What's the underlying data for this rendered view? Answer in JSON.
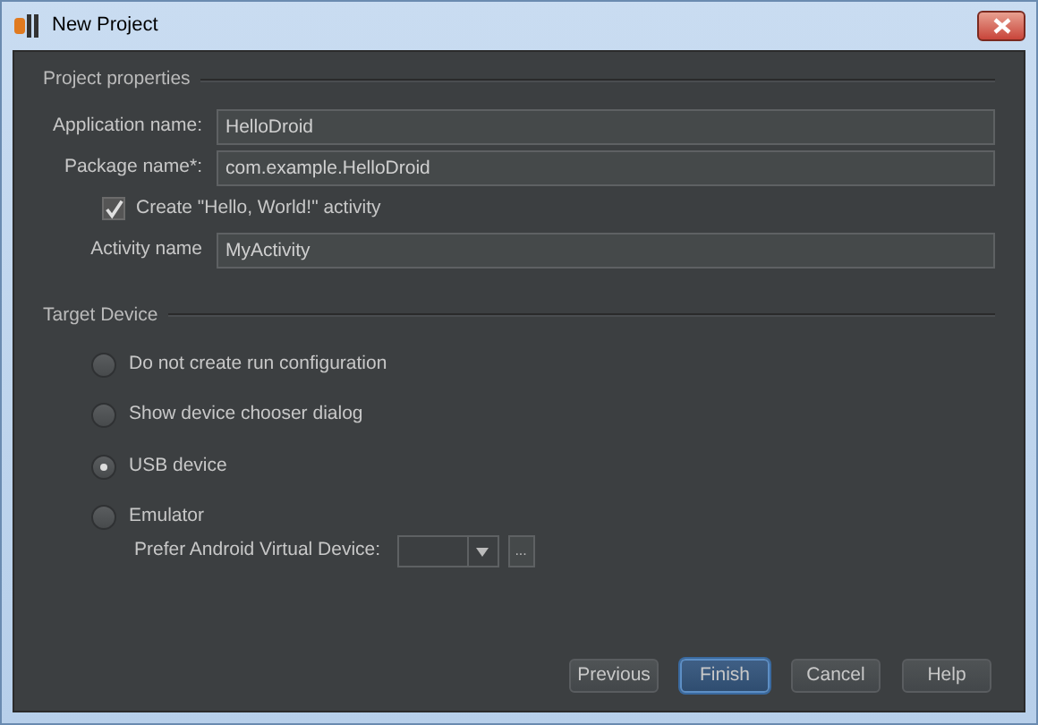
{
  "window": {
    "title": "New Project"
  },
  "project_properties": {
    "title": "Project properties",
    "fields": [
      {
        "label": "Application name:",
        "value": "HelloDroid"
      },
      {
        "label": "Package name*:",
        "value": "com.example.HelloDroid"
      }
    ],
    "create_activity": {
      "label": "Create \"Hello, World!\" activity",
      "checked": true
    },
    "activity_name": {
      "label": "Activity name",
      "value": "MyActivity"
    }
  },
  "target_device": {
    "title": "Target Device",
    "options": [
      {
        "label": "Do not create run configuration",
        "selected": false
      },
      {
        "label": "Show device chooser dialog",
        "selected": false
      },
      {
        "label": "USB device",
        "selected": true
      },
      {
        "label": "Emulator",
        "selected": false
      }
    ],
    "avd": {
      "label": "Prefer Android Virtual Device:",
      "browse": "..."
    }
  },
  "buttons": [
    {
      "label": "Previous",
      "focused": false
    },
    {
      "label": "Finish",
      "focused": true
    },
    {
      "label": "Cancel",
      "focused": false
    },
    {
      "label": "Help",
      "focused": false
    }
  ]
}
